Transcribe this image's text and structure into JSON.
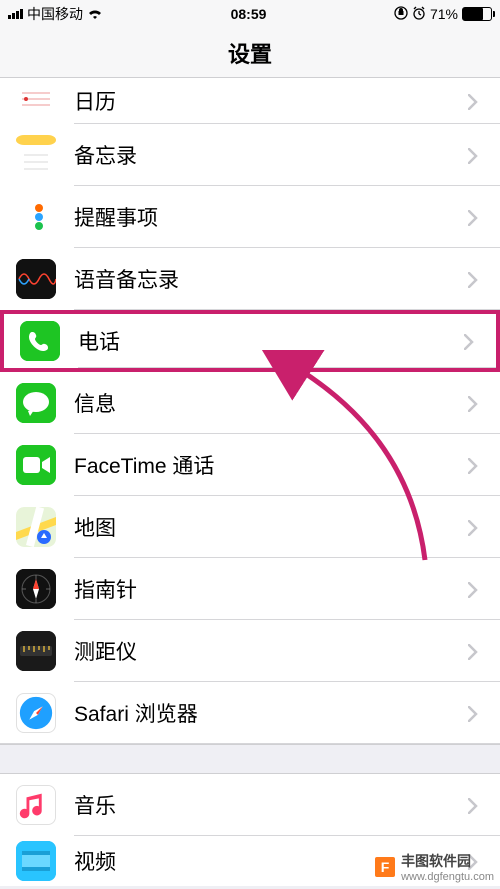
{
  "status": {
    "carrier": "中国移动",
    "network": "",
    "time": "08:59",
    "battery_pct": "71%"
  },
  "nav": {
    "title": "设置"
  },
  "rows": {
    "calendar": "日历",
    "notes": "备忘录",
    "reminders": "提醒事项",
    "voicememo": "语音备忘录",
    "phone": "电话",
    "messages": "信息",
    "facetime": "FaceTime 通话",
    "maps": "地图",
    "compass": "指南针",
    "measure": "测距仪",
    "safari": "Safari 浏览器",
    "music": "音乐",
    "videos": "视频"
  },
  "watermark": {
    "name": "丰图软件园",
    "url": "www.dgfengtu.com"
  }
}
